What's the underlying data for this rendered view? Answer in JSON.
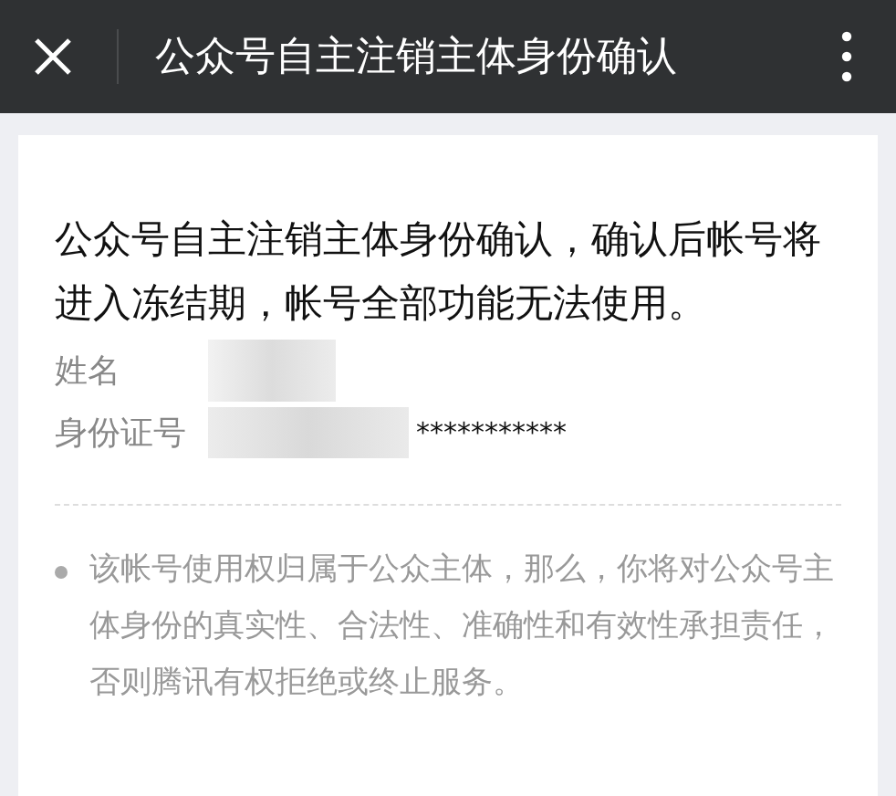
{
  "header": {
    "title": "公众号自主注销主体身份确认"
  },
  "notice": "公众号自主注销主体身份确认，确认后帐号将进入冻结期，帐号全部功能无法使用。",
  "fields": [
    {
      "label": "姓名",
      "kind": "redacted"
    },
    {
      "label": "身份证号",
      "kind": "masked",
      "value": "***********"
    }
  ],
  "notes": [
    "该帐号使用权归属于公众主体，那么，你将对公众号主体身份的真实性、合法性、准确性和有效性承担责任，否则腾讯有权拒绝或终止服务。"
  ]
}
